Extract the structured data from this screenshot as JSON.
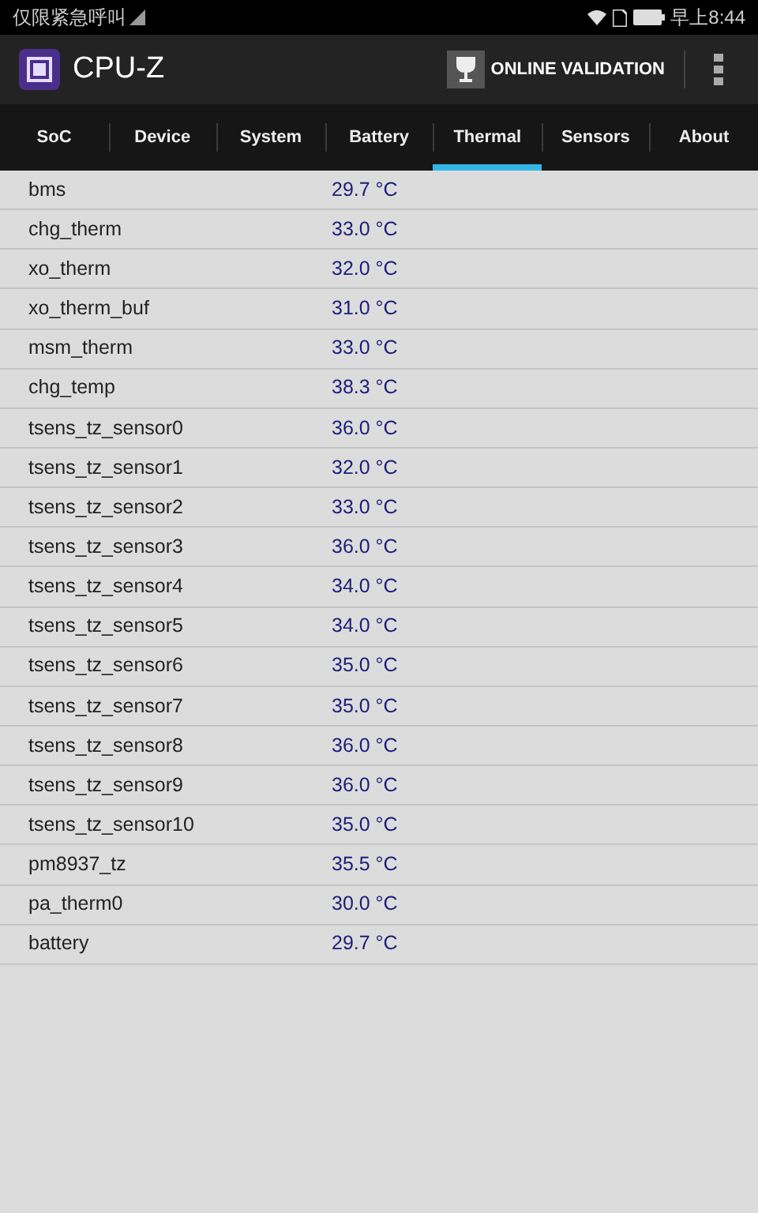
{
  "status_bar": {
    "carrier": "仅限紧急呼叫",
    "time": "早上8:44"
  },
  "app_bar": {
    "title": "CPU-Z",
    "action": "ONLINE VALIDATION"
  },
  "tabs": [
    {
      "label": "SoC",
      "selected": false
    },
    {
      "label": "Device",
      "selected": false
    },
    {
      "label": "System",
      "selected": false
    },
    {
      "label": "Battery",
      "selected": false
    },
    {
      "label": "Thermal",
      "selected": true
    },
    {
      "label": "Sensors",
      "selected": false
    },
    {
      "label": "About",
      "selected": false
    }
  ],
  "rows": [
    {
      "name": "bms",
      "value": "29.7 °C"
    },
    {
      "name": "chg_therm",
      "value": "33.0 °C"
    },
    {
      "name": "xo_therm",
      "value": "32.0 °C"
    },
    {
      "name": "xo_therm_buf",
      "value": "31.0 °C"
    },
    {
      "name": "msm_therm",
      "value": "33.0 °C"
    },
    {
      "name": "chg_temp",
      "value": "38.3 °C"
    },
    {
      "name": "tsens_tz_sensor0",
      "value": "36.0 °C"
    },
    {
      "name": "tsens_tz_sensor1",
      "value": "32.0 °C"
    },
    {
      "name": "tsens_tz_sensor2",
      "value": "33.0 °C"
    },
    {
      "name": "tsens_tz_sensor3",
      "value": "36.0 °C"
    },
    {
      "name": "tsens_tz_sensor4",
      "value": "34.0 °C"
    },
    {
      "name": "tsens_tz_sensor5",
      "value": "34.0 °C"
    },
    {
      "name": "tsens_tz_sensor6",
      "value": "35.0 °C"
    },
    {
      "name": "tsens_tz_sensor7",
      "value": "35.0 °C"
    },
    {
      "name": "tsens_tz_sensor8",
      "value": "36.0 °C"
    },
    {
      "name": "tsens_tz_sensor9",
      "value": "36.0 °C"
    },
    {
      "name": "tsens_tz_sensor10",
      "value": "35.0 °C"
    },
    {
      "name": "pm8937_tz",
      "value": "35.5 °C"
    },
    {
      "name": "pa_therm0",
      "value": "30.0 °C"
    },
    {
      "name": "battery",
      "value": "29.7 °C"
    }
  ]
}
